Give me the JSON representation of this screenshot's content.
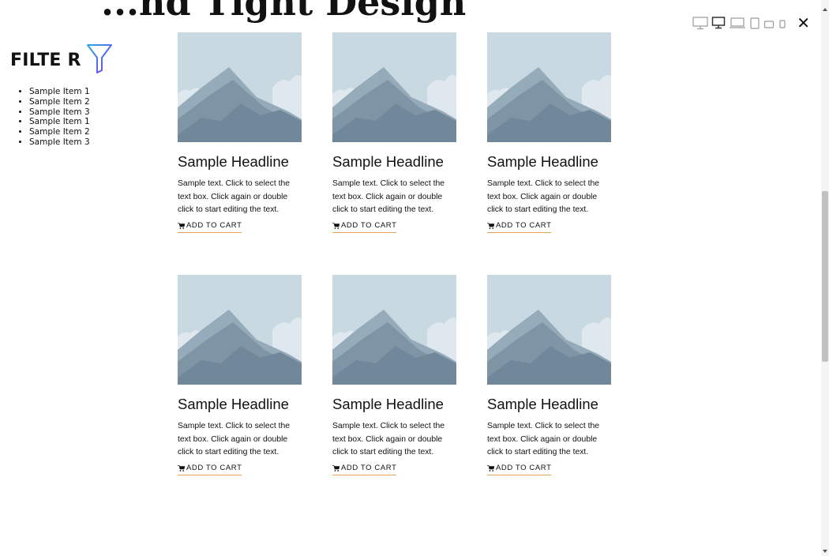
{
  "header": {
    "heading_fragment": "...nd Tight Design"
  },
  "toolbar": {
    "devices": [
      {
        "name": "desktop-large",
        "icon": "monitor-icon"
      },
      {
        "name": "desktop",
        "icon": "monitor-icon"
      },
      {
        "name": "laptop",
        "icon": "laptop-icon"
      },
      {
        "name": "tablet",
        "icon": "tablet-icon"
      },
      {
        "name": "tablet-landscape",
        "icon": "tablet-landscape-icon"
      },
      {
        "name": "phone",
        "icon": "phone-icon"
      }
    ],
    "close_label": "✕"
  },
  "filter": {
    "title": "FILTE R",
    "icon": "funnel-icon",
    "items": [
      "Sample Item 1",
      "Sample Item 2",
      "Sample Item 3",
      "Sample Item 1",
      "Sample Item 2",
      "Sample Item 3"
    ]
  },
  "products": [
    {
      "headline": "Sample Headline",
      "text": "Sample text. Click to select the text box. Click again or double click to start editing the text.",
      "cta": "ADD TO CART"
    },
    {
      "headline": "Sample Headline",
      "text": "Sample text. Click to select the text box. Click again or double click to start editing the text.",
      "cta": "ADD TO CART"
    },
    {
      "headline": "Sample Headline",
      "text": "Sample text. Click to select the text box. Click again or double click to start editing the text.",
      "cta": "ADD TO CART"
    },
    {
      "headline": "Sample Headline",
      "text": "Sample text. Click to select the text box. Click again or double click to start editing the text.",
      "cta": "ADD TO CART"
    },
    {
      "headline": "Sample Headline",
      "text": "Sample text. Click to select the text box. Click again or double click to start editing the text.",
      "cta": "ADD TO CART"
    },
    {
      "headline": "Sample Headline",
      "text": "Sample text. Click to select the text box. Click again or double click to start editing the text.",
      "cta": "ADD TO CART"
    }
  ],
  "colors": {
    "cart_underline": "#e6a15a",
    "image_sky": "#c9d9e2",
    "image_mountain": "#8aa1b1",
    "filter_icon_start": "#2aa6e6",
    "filter_icon_end": "#7a3cf0"
  }
}
